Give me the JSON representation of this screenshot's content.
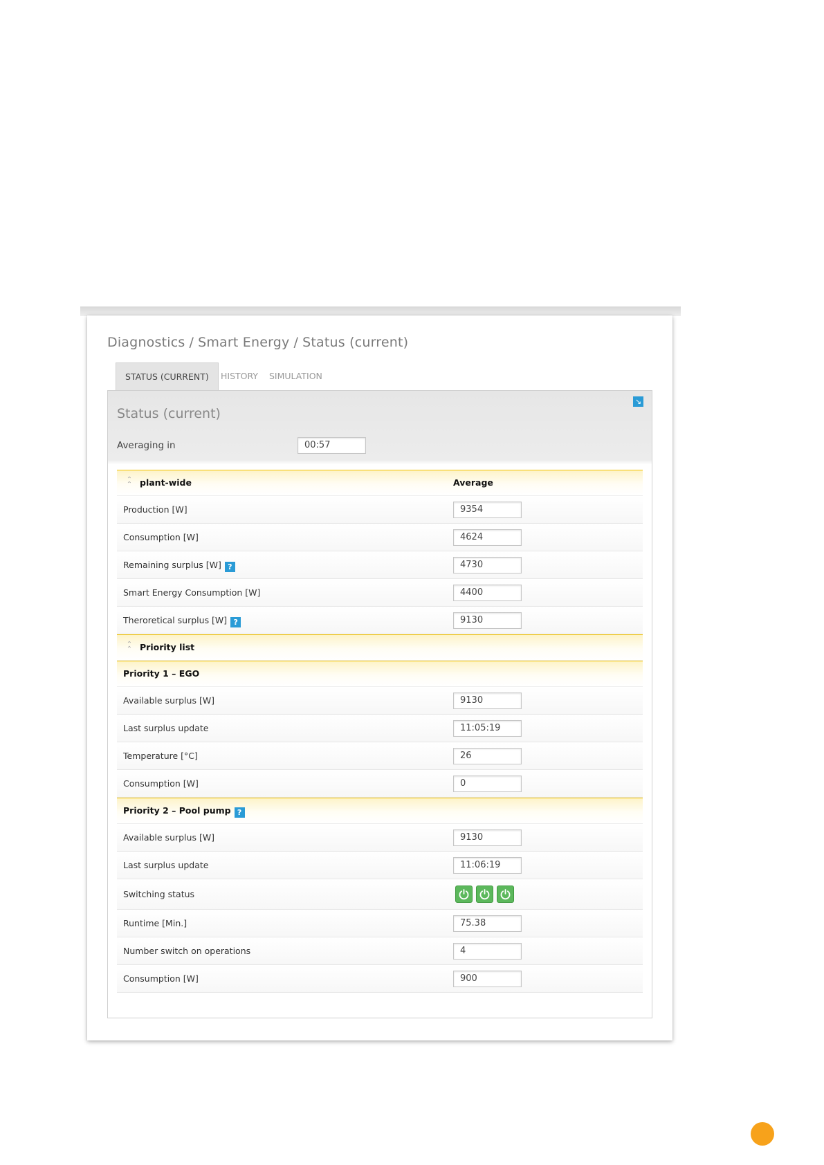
{
  "breadcrumb": [
    "Diagnostics",
    "Smart Energy",
    "Status (current)"
  ],
  "tabs": [
    "STATUS (CURRENT)",
    "HISTORY",
    "SIMULATION"
  ],
  "panel": {
    "title": "Status (current)",
    "averaging_label": "Averaging in",
    "averaging_value": "00:57"
  },
  "plant_wide": {
    "header": "plant-wide",
    "column": "Average",
    "rows": [
      {
        "label": "Production [W]",
        "value": "9354"
      },
      {
        "label": "Consumption [W]",
        "value": "4624"
      },
      {
        "label": "Remaining surplus [W]",
        "value": "4730"
      },
      {
        "label": "Smart Energy Consumption [W]",
        "value": "4400"
      },
      {
        "label": "Theroretical surplus [W]",
        "value": "9130"
      }
    ]
  },
  "priority_list": {
    "header": "Priority list",
    "p1": {
      "header": "Priority 1 – EGO",
      "rows": [
        {
          "label": "Available surplus [W]",
          "value": "9130"
        },
        {
          "label": "Last surplus update",
          "value": "11:05:19"
        },
        {
          "label": "Temperature [°C]",
          "value": "26"
        },
        {
          "label": "Consumption [W]",
          "value": "0"
        }
      ]
    },
    "p2": {
      "header": "Priority 2 – Pool pump",
      "rows": [
        {
          "label": "Available surplus [W]",
          "value": "9130"
        },
        {
          "label": "Last surplus update",
          "value": "11:06:19"
        },
        {
          "label": "Switching status"
        },
        {
          "label": "Runtime [Min.]",
          "value": "75.38"
        },
        {
          "label": "Number switch on operations",
          "value": "4"
        },
        {
          "label": "Consumption [W]",
          "value": "900"
        }
      ]
    }
  },
  "icons": {
    "help": "?",
    "expand": "↘",
    "collapse": "⌃",
    "power": "power-icon",
    "power_count": 3
  },
  "colors": {
    "accent_blue": "#2a9bd6",
    "section_yellow": "#f2c200",
    "power_green": "#5cb85c",
    "page_badge": "#f7a21b"
  }
}
